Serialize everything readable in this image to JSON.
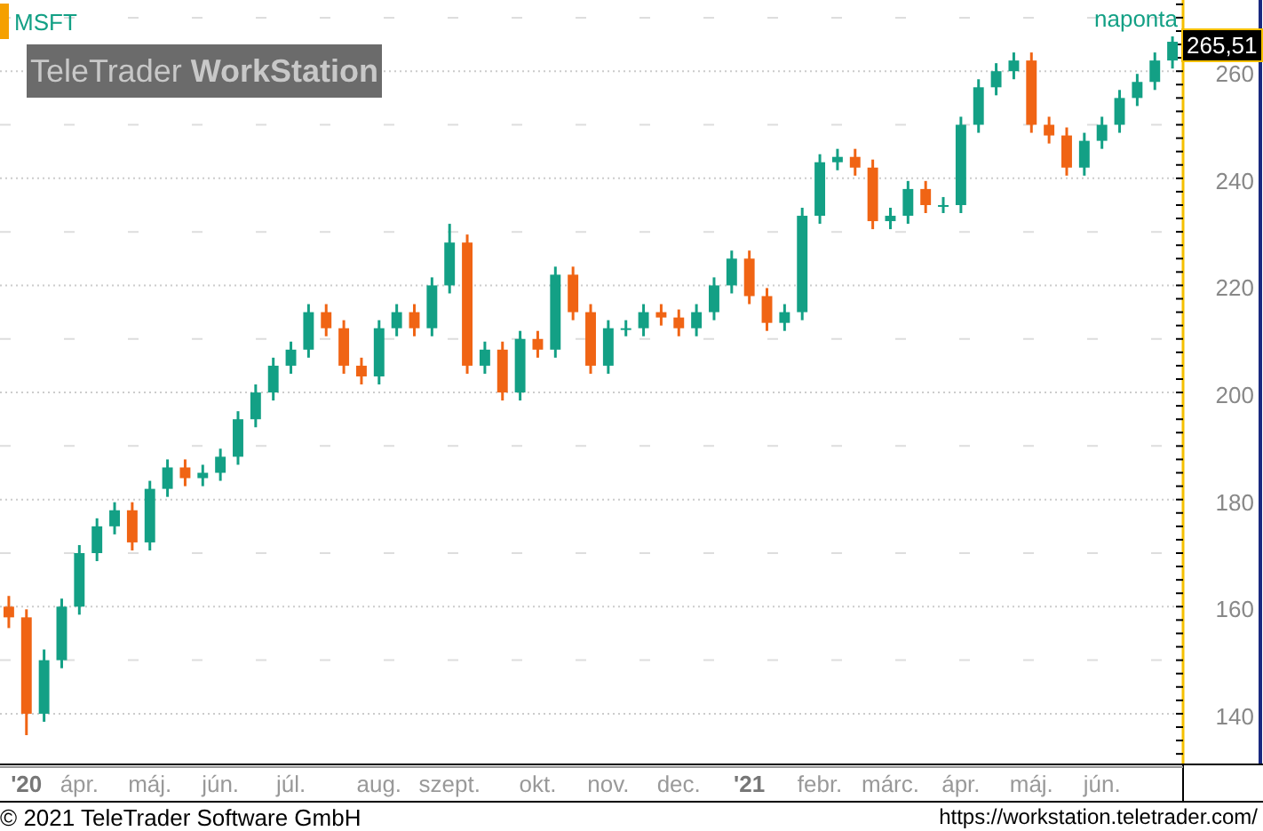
{
  "chart": {
    "interval": "naponta",
    "logo": {
      "light": "TeleTrader",
      "bold": "WorkStation"
    },
    "last_price": "265,51",
    "chart_data": {
      "type": "candlestick",
      "title": "MSFT",
      "grid": true,
      "ylim": [
        130.7,
        273.3
      ],
      "categories": [
        null,
        "'20",
        null,
        null,
        "ápr.",
        null,
        null,
        null,
        "máj.",
        null,
        null,
        null,
        "jún.",
        null,
        null,
        null,
        "júl.",
        null,
        null,
        null,
        null,
        "aug.",
        null,
        null,
        null,
        "szept.",
        null,
        null,
        null,
        null,
        "okt.",
        null,
        null,
        null,
        "nov.",
        null,
        null,
        null,
        "dec.",
        null,
        null,
        null,
        "'21",
        null,
        null,
        null,
        "febr.",
        null,
        null,
        null,
        "márc.",
        null,
        null,
        null,
        "ápr.",
        null,
        null,
        null,
        "máj.",
        null,
        null,
        null,
        "jún.",
        null,
        null,
        null,
        null
      ],
      "ohlc": [
        [
          160,
          162,
          156,
          158
        ],
        [
          158,
          159.5,
          136,
          140
        ],
        [
          140,
          152,
          138.5,
          150
        ],
        [
          150,
          161.5,
          148.5,
          160
        ],
        [
          160,
          171.5,
          158.5,
          170
        ],
        [
          170,
          176.5,
          168.5,
          175
        ],
        [
          175,
          179.5,
          173.5,
          178
        ],
        [
          178,
          179.5,
          170.5,
          172
        ],
        [
          172,
          183.5,
          170.5,
          182
        ],
        [
          182,
          187.5,
          180.5,
          186
        ],
        [
          186,
          187.5,
          182.5,
          184
        ],
        [
          184,
          186.5,
          182.5,
          185
        ],
        [
          185,
          189.5,
          183.5,
          188
        ],
        [
          188,
          196.5,
          186.5,
          195
        ],
        [
          195,
          201.5,
          193.5,
          200
        ],
        [
          200,
          206.5,
          198.5,
          205
        ],
        [
          205,
          209.5,
          203.5,
          208
        ],
        [
          208,
          216.5,
          206.5,
          215
        ],
        [
          215,
          216.5,
          210.5,
          212
        ],
        [
          212,
          213.5,
          203.5,
          205
        ],
        [
          205,
          206.5,
          201.5,
          203
        ],
        [
          203,
          213.5,
          201.5,
          212
        ],
        [
          212,
          216.5,
          210.5,
          215
        ],
        [
          215,
          216.5,
          210.5,
          212
        ],
        [
          212,
          221.5,
          210.5,
          220
        ],
        [
          220,
          231.5,
          218.5,
          228
        ],
        [
          228,
          229.5,
          203.5,
          205
        ],
        [
          205,
          209.5,
          203.5,
          208
        ],
        [
          208,
          209.5,
          198.5,
          200
        ],
        [
          200,
          211.5,
          198.5,
          210
        ],
        [
          210,
          211.5,
          206.5,
          208
        ],
        [
          208,
          223.5,
          206.5,
          222
        ],
        [
          222,
          223.5,
          213.5,
          215
        ],
        [
          215,
          216.5,
          203.5,
          205
        ],
        [
          205,
          213.5,
          203.5,
          212
        ],
        [
          212,
          213.5,
          210.5,
          212
        ],
        [
          212,
          216.5,
          210.5,
          215
        ],
        [
          215,
          216.5,
          212.5,
          214
        ],
        [
          214,
          215.5,
          210.5,
          212
        ],
        [
          212,
          216.5,
          210.5,
          215
        ],
        [
          215,
          221.5,
          213.5,
          220
        ],
        [
          220,
          226.5,
          218.5,
          225
        ],
        [
          225,
          226.5,
          216.5,
          218
        ],
        [
          218,
          219.5,
          211.5,
          213
        ],
        [
          213,
          216.5,
          211.5,
          215
        ],
        [
          215,
          234.5,
          213.5,
          233
        ],
        [
          233,
          244.5,
          231.5,
          243
        ],
        [
          243,
          245.5,
          241.5,
          244
        ],
        [
          244,
          245.5,
          240.5,
          242
        ],
        [
          242,
          243.5,
          230.5,
          232
        ],
        [
          232,
          234.5,
          230.5,
          233
        ],
        [
          233,
          239.5,
          231.5,
          238
        ],
        [
          238,
          239.5,
          233.5,
          235
        ],
        [
          235,
          236.5,
          233.5,
          235
        ],
        [
          235,
          251.5,
          233.5,
          250
        ],
        [
          250,
          258.5,
          248.5,
          257
        ],
        [
          257,
          261.5,
          255.5,
          260
        ],
        [
          260,
          263.5,
          258.5,
          262
        ],
        [
          262,
          263.5,
          248.5,
          250
        ],
        [
          250,
          251.5,
          246.5,
          248
        ],
        [
          248,
          249.5,
          240.5,
          242
        ],
        [
          242,
          248.5,
          240.5,
          247
        ],
        [
          247,
          251.5,
          245.5,
          250
        ],
        [
          250,
          256.5,
          248.5,
          255
        ],
        [
          255,
          259.5,
          253.5,
          258
        ],
        [
          258,
          263.5,
          256.5,
          262
        ],
        [
          262,
          266.5,
          260.5,
          265.5
        ]
      ],
      "yticks": [
        140,
        160,
        180,
        200,
        220,
        240,
        260
      ]
    }
  },
  "footer": {
    "copyright": "© 2021 TeleTrader Software GmbH",
    "url": "https://workstation.teletrader.com/"
  }
}
